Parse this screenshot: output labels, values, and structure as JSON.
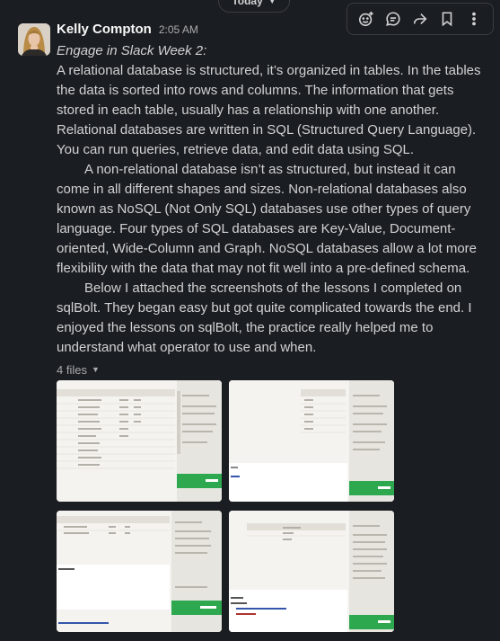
{
  "date_divider": {
    "label": "Today"
  },
  "toolbar": {
    "actions": [
      "add-reaction",
      "reply-in-thread",
      "share-message",
      "save-for-later",
      "more-actions"
    ]
  },
  "message": {
    "author": "Kelly Compton",
    "time": "2:05 AM",
    "subject": "Engage in Slack Week 2:",
    "paragraphs": [
      "A relational database is structured, it’s organized in tables. In the tables the data is sorted into rows and columns. The information that gets stored in each table, usually has a relationship with one another. Relational databases are written in SQL (Structured Query Language). You can run queries, retrieve data, and edit data using SQL.",
      "A non-relational database isn’t as structured, but instead it can come in all different shapes and sizes. Non-relational databases also known as NoSQL (Not Only SQL) databases use other types of query language. Four types of SQL databases are Key-Value, Document-oriented, Wide-Column and Graph. NoSQL databases allow a lot more flexibility with the data that may not fit well into a pre-defined schema.",
      "Below I attached the screenshots of the lessons I completed on sqlBolt. They began easy but got quite complicated towards the end. I enjoyed the lessons on sqlBolt, the practice really helped me to understand what operator to use and when."
    ],
    "files_label": "4 files",
    "attachments": [
      {
        "name": "sqlbolt-lesson-screenshot-1"
      },
      {
        "name": "sqlbolt-lesson-screenshot-2"
      },
      {
        "name": "sqlbolt-lesson-screenshot-3"
      },
      {
        "name": "sqlbolt-lesson-screenshot-4"
      }
    ]
  },
  "colors": {
    "background": "#1a1d21",
    "text": "#d1d2d3",
    "author": "#f8f8f8",
    "muted": "#ababad",
    "sqlbolt_green": "#2ea84f"
  }
}
